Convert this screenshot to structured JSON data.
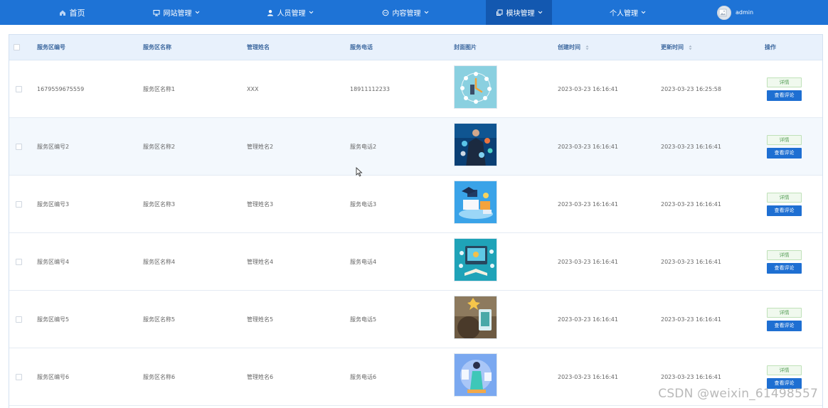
{
  "nav": {
    "home": "首页",
    "website": "网站管理",
    "personnel": "人员管理",
    "content": "内容管理",
    "module": "模块管理",
    "personal": "个人管理",
    "user": "admin"
  },
  "table": {
    "headers": {
      "code": "服务区编号",
      "name": "服务区名称",
      "manager": "管理姓名",
      "phone": "服务电话",
      "cover": "封面图片",
      "created": "创建时间",
      "updated": "更新时间",
      "actions": "操作"
    },
    "rows": [
      {
        "code": "1679559675559",
        "name": "服务区名称1",
        "manager": "XXX",
        "phone": "18911112233",
        "created": "2023-03-23 16:16:41",
        "updated": "2023-03-23 16:25:58"
      },
      {
        "code": "服务区编号2",
        "name": "服务区名称2",
        "manager": "管理姓名2",
        "phone": "服务电话2",
        "created": "2023-03-23 16:16:41",
        "updated": "2023-03-23 16:16:41"
      },
      {
        "code": "服务区编号3",
        "name": "服务区名称3",
        "manager": "管理姓名3",
        "phone": "服务电话3",
        "created": "2023-03-23 16:16:41",
        "updated": "2023-03-23 16:16:41"
      },
      {
        "code": "服务区编号4",
        "name": "服务区名称4",
        "manager": "管理姓名4",
        "phone": "服务电话4",
        "created": "2023-03-23 16:16:41",
        "updated": "2023-03-23 16:16:41"
      },
      {
        "code": "服务区编号5",
        "name": "服务区名称5",
        "manager": "管理姓名5",
        "phone": "服务电话5",
        "created": "2023-03-23 16:16:41",
        "updated": "2023-03-23 16:16:41"
      },
      {
        "code": "服务区编号6",
        "name": "服务区名称6",
        "manager": "管理姓名6",
        "phone": "服务电话6",
        "created": "2023-03-23 16:16:41",
        "updated": "2023-03-23 16:16:41"
      }
    ],
    "detail_label": "详情",
    "review_label": "查看评论"
  },
  "watermark": "CSDN @weixin_61498557",
  "colors": {
    "nav_bg": "#1e73d6",
    "nav_active": "#1358b0",
    "header_bg": "#e8f1fc",
    "review_button": "#1e6fd2"
  }
}
